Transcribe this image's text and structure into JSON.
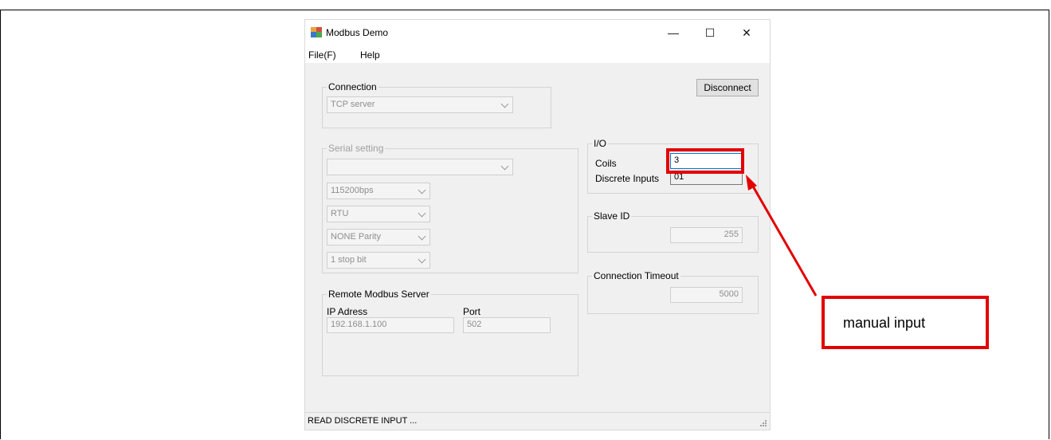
{
  "window": {
    "title": "Modbus Demo",
    "minimize_glyph": "—",
    "maximize_glyph": "☐",
    "close_glyph": "✕",
    "icon": "app-window-icon"
  },
  "menu": {
    "file": "File(F)",
    "help": "Help"
  },
  "connection": {
    "label": "Connection",
    "mode": "TCP server"
  },
  "disconnect_label": "Disconnect",
  "serial": {
    "label": "Serial setting",
    "port": "",
    "baud": "115200bps",
    "mode": "RTU",
    "parity": "NONE Parity",
    "stop": "1 stop bit"
  },
  "remote": {
    "label": "Remote Modbus Server",
    "ip_label": "IP Adress",
    "ip_value": "192.168.1.100",
    "port_label": "Port",
    "port_value": "502"
  },
  "io": {
    "label": "I/O",
    "coils_label": "Coils",
    "coils_value": "3",
    "discrete_label": "Discrete Inputs",
    "discrete_value": "01"
  },
  "slave": {
    "label": "Slave ID",
    "value": "255"
  },
  "timeout": {
    "label": "Connection Timeout",
    "value": "5000"
  },
  "status": "READ DISCRETE INPUT ...",
  "annotation": {
    "text": "manual input",
    "color": "#e20000"
  }
}
